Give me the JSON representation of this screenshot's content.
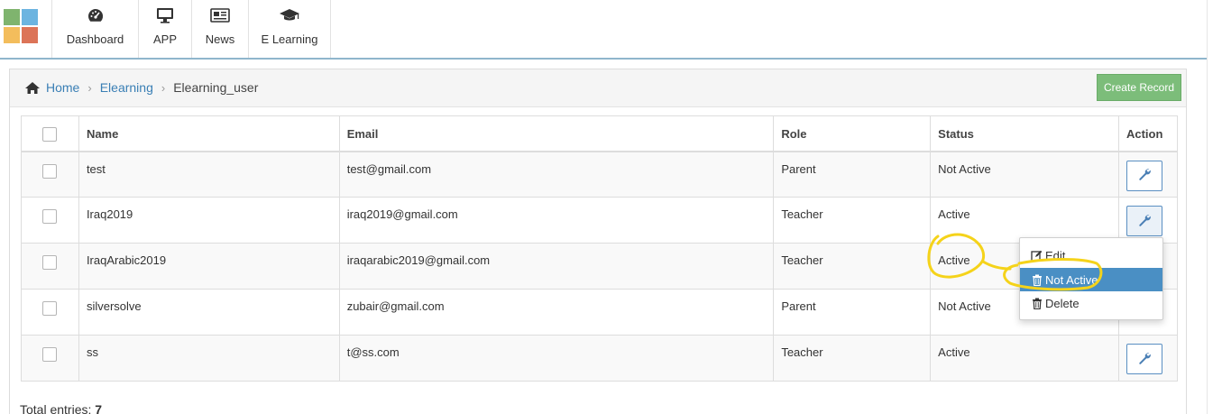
{
  "nav": {
    "items": [
      {
        "label": "Dashboard",
        "icon": "dashboard-icon"
      },
      {
        "label": "APP",
        "icon": "monitor-icon"
      },
      {
        "label": "News",
        "icon": "newspaper-icon"
      },
      {
        "label": "E Learning",
        "icon": "graduation-cap-icon"
      }
    ],
    "logo_colors": [
      "#7fb46e",
      "#6cb4e0",
      "#f3bd5c",
      "#dc7458"
    ]
  },
  "breadcrumb": {
    "home": "Home",
    "section": "Elearning",
    "current": "Elearning_user"
  },
  "toolbar": {
    "create_label": "Create Record"
  },
  "table": {
    "headers": {
      "name": "Name",
      "email": "Email",
      "role": "Role",
      "status": "Status",
      "action": "Action"
    },
    "rows": [
      {
        "name": "test",
        "email": "test@gmail.com",
        "role": "Parent",
        "status": "Not Active"
      },
      {
        "name": "Iraq2019",
        "email": "iraq2019@gmail.com",
        "role": "Teacher",
        "status": "Active"
      },
      {
        "name": "IraqArabic2019",
        "email": "iraqarabic2019@gmail.com",
        "role": "Teacher",
        "status": "Active"
      },
      {
        "name": "silversolve",
        "email": "zubair@gmail.com",
        "role": "Parent",
        "status": "Not Active"
      },
      {
        "name": "ss",
        "email": "t@ss.com",
        "role": "Teacher",
        "status": "Active"
      }
    ]
  },
  "footer": {
    "total_label": "Total entries:",
    "total_value": "7"
  },
  "action_menu": {
    "items": [
      {
        "label": "Edit",
        "icon": "edit-icon"
      },
      {
        "label": "Not Active",
        "icon": "trash-icon"
      },
      {
        "label": "Delete",
        "icon": "trash-icon"
      }
    ]
  },
  "colors": {
    "accent": "#3a7fb5",
    "create_button": "#7cbd7a",
    "menu_highlight": "#4a8fc4",
    "annotation": "#f5d31a"
  }
}
